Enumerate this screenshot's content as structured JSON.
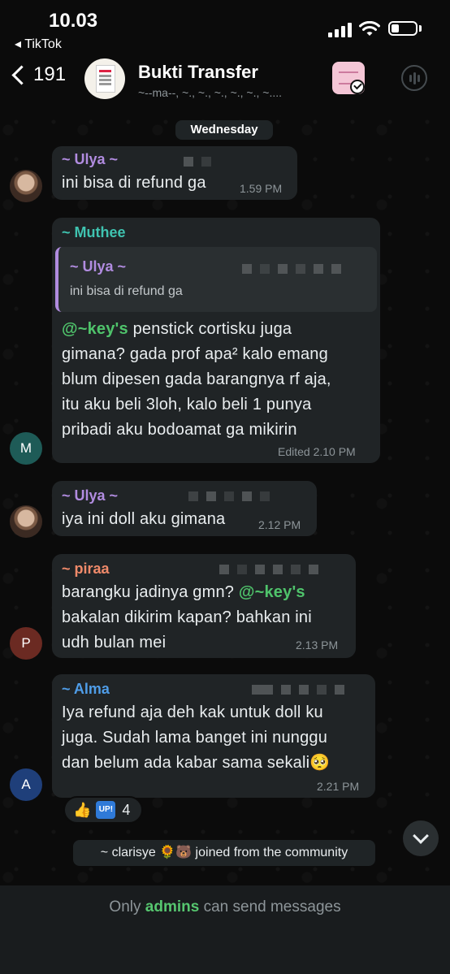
{
  "status_bar": {
    "time": "10.03",
    "back_app": "◂ TikTok"
  },
  "header": {
    "back_count": "191",
    "title": "Bukti Transfer",
    "subtitle": "~--ma--, ~., ~., ~., ~., ~., ~...."
  },
  "date_label": "Wednesday",
  "messages": [
    {
      "sender": "~ Ulya ~",
      "sender_color": "#b18ce0",
      "text": "ini bisa di refund ga",
      "time": "1.59 PM",
      "avatar": "photo"
    },
    {
      "sender": "~ Muthee",
      "sender_color": "#3fc3b0",
      "quote_sender": "~ Ulya ~",
      "quote_text": "ini bisa di refund ga",
      "mention": "@~key's",
      "text_lines": [
        "penstick cortisku juga",
        "gimana? gada prof apa² kalo emang",
        "blum dipesen gada barangnya rf aja,",
        "itu aku beli 3loh, kalo beli 1 punya",
        "pribadi aku bodoamat ga mikirin"
      ],
      "time": "Edited 2.10 PM",
      "avatar_letter": "M",
      "avatar_color": "#1e5b57"
    },
    {
      "sender": "~ Ulya ~",
      "sender_color": "#b18ce0",
      "text": "iya ini doll aku gimana",
      "time": "2.12 PM",
      "avatar": "photo"
    },
    {
      "sender": "~ piraa",
      "sender_color": "#f08a6a",
      "text_start": "barangku jadinya gmn?",
      "mention": "@~key's",
      "text_lines": [
        "bakalan dikirim kapan? bahkan ini",
        "udh bulan mei"
      ],
      "time": "2.13 PM",
      "avatar_letter": "P",
      "avatar_color": "#6b2a22"
    },
    {
      "sender": "~ Alma",
      "sender_color": "#4f9de8",
      "text_lines": [
        "Iya refund aja deh kak untuk doll ku",
        "juga. Sudah lama banget ini nunggu",
        "dan belum ada kabar sama sekali🥺"
      ],
      "time": "2.21 PM",
      "avatar_letter": "A",
      "avatar_color": "#1f3f7a"
    }
  ],
  "reactions": {
    "emoji": "👍",
    "badge": "UP!",
    "count": "4"
  },
  "system_message": "~ clarisye 🌻🐻 joined from the community",
  "footer": {
    "prefix": "Only ",
    "admins": "admins",
    "suffix": " can send messages"
  }
}
